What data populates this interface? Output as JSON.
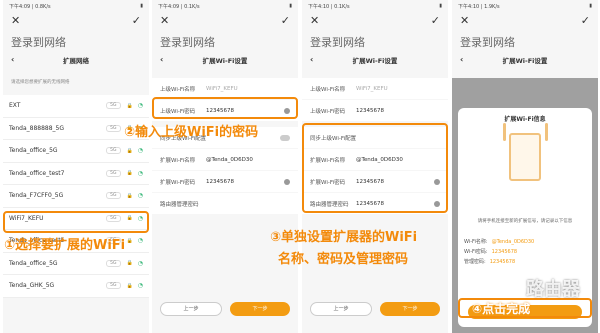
{
  "screens": [
    {
      "status_time": "下午4:09 | 0.8K/s",
      "title": "登录到网络",
      "subtitle": "扩展网络",
      "hint": "请选择您想要扩展的无线网络",
      "networks": [
        {
          "name": "EXT",
          "band": "5G"
        },
        {
          "name": "Tenda_888888_5G",
          "band": "5G"
        },
        {
          "name": "Tenda_office_5G",
          "band": "5G"
        },
        {
          "name": "Tenda_office_test7",
          "band": "5G"
        },
        {
          "name": "Tenda_F7CFF0_5G",
          "band": "5G"
        },
        {
          "name": "WiFi7_KEFU",
          "band": "5G"
        },
        {
          "name": "Tenda_office_test5",
          "band": "5G"
        },
        {
          "name": "Tenda_office_5G",
          "band": "5G"
        },
        {
          "name": "Tenda_GHK_5G",
          "band": "5G"
        }
      ]
    },
    {
      "status_time": "下午4:09 | 0.1K/s",
      "title": "登录到网络",
      "subtitle": "扩展Wi-Fi设置",
      "fields": [
        {
          "label": "上级Wi-Fi名称",
          "value": "WiFi7_KEFU"
        },
        {
          "label": "上级Wi-Fi密码",
          "value": "12345678"
        },
        {
          "label": "同步上级Wi-Fi配置",
          "value": ""
        },
        {
          "label": "扩展Wi-Fi名称",
          "value": "@Tenda_0D6D30"
        },
        {
          "label": "扩展Wi-Fi密码",
          "value": "12345678"
        },
        {
          "label": "路由器管理密码",
          "value": ""
        }
      ],
      "prev": "上一步",
      "next": "下一步"
    },
    {
      "status_time": "下午4:10 | 0.1K/s",
      "title": "登录到网络",
      "subtitle": "扩展Wi-Fi设置",
      "fields": [
        {
          "label": "上级Wi-Fi名称",
          "value": "WiFi7_KEFU"
        },
        {
          "label": "上级Wi-Fi密码",
          "value": "12345678"
        },
        {
          "label": "同步上级Wi-Fi配置",
          "value": ""
        },
        {
          "label": "扩展Wi-Fi名称",
          "value": "@Tenda_0D6D30"
        },
        {
          "label": "扩展Wi-Fi密码",
          "value": "12345678"
        },
        {
          "label": "路由器管理密码",
          "value": "12345678"
        }
      ],
      "prev": "上一步",
      "next": "下一步"
    },
    {
      "status_time": "下午4:10 | 1.9K/s",
      "title": "登录到网络",
      "subtitle": "扩展Wi-Fi设置",
      "dialog": {
        "title": "扩展Wi-Fi信息",
        "desc": "请将手机连接至新的扩展信号，请记录以下信息",
        "wifi_name_label": "Wi-Fi名称:",
        "wifi_name": "@Tenda_0D6D30",
        "wifi_pwd_label": "Wi-Fi密码:",
        "wifi_pwd": "12345678",
        "admin_label": "管理密码:",
        "admin_pwd": "12345678",
        "button": "完成"
      }
    }
  ],
  "annotations": {
    "step1": "①选择要扩展的WiFi",
    "step2": "②输入上级WiFi的密码",
    "step3_line1": "③单独设置扩展器的WiFi",
    "step3_line2": "名称、密码及管理密码",
    "step4": "④点击完成"
  },
  "watermark": "路由器",
  "accent": "#f38a0b"
}
